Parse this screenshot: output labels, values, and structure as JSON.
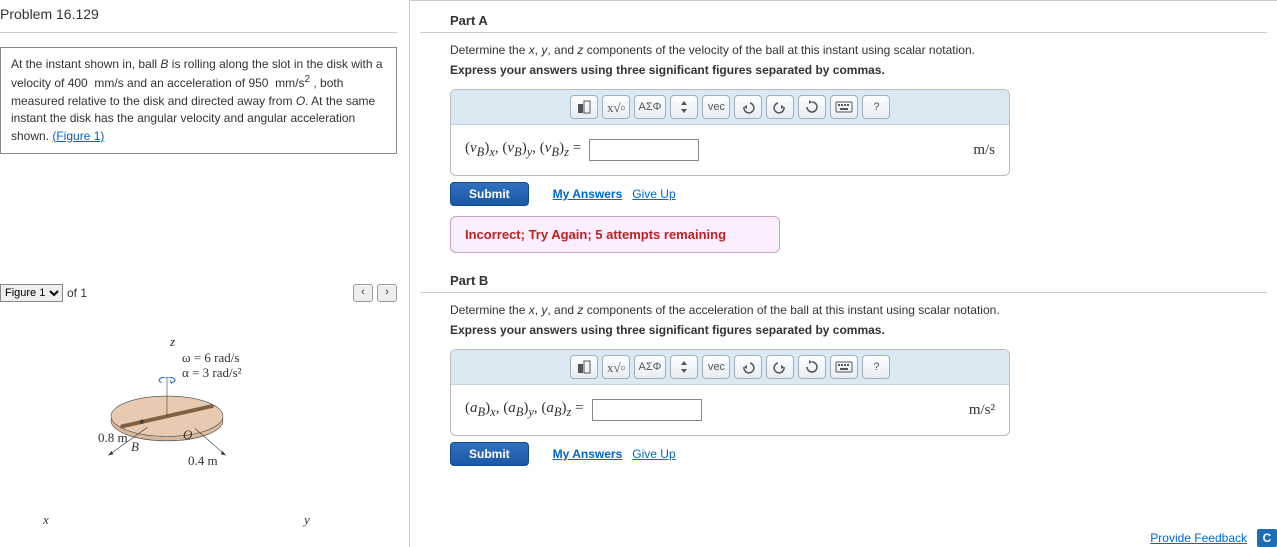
{
  "problem": {
    "title": "Problem 16.129",
    "description_lines": [
      "At the instant shown in, ball B is rolling along the slot in the disk with",
      "a velocity of 400 mm/s and an acceleration of 950 mm/s² , both",
      "measured relative to the disk and directed away from O. At the same",
      "instant the disk has the angular velocity and angular acceleration",
      "shown."
    ],
    "figure_link": "(Figure 1)",
    "figure_selector_value": "Figure 1",
    "figure_of_text": "of 1",
    "figure_labels": {
      "z": "z",
      "x": "x",
      "y": "y",
      "O": "O",
      "B": "B",
      "r1": "0.8 m",
      "r2": "0.4 m",
      "omega": "ω = 6 rad/s",
      "alpha": "α = 3 rad/s²"
    }
  },
  "partA": {
    "title": "Part A",
    "prompt": "Determine the x, y, and z components of the velocity of the ball at this instant using scalar notation.",
    "instr": "Express your answers using three significant figures separated by commas.",
    "lhs": "(vB)x, (vB)y, (vB)z =",
    "units": "m/s",
    "submit": "Submit",
    "my_answers": "My Answers",
    "give_up": "Give Up",
    "feedback": "Incorrect; Try Again; 5 attempts remaining"
  },
  "partB": {
    "title": "Part B",
    "prompt": "Determine the x, y, and z components of the acceleration of the ball at this instant using scalar notation.",
    "instr": "Express your answers using three significant figures separated by commas.",
    "lhs": "(aB)x, (aB)y, (aB)z =",
    "units": "m/s²",
    "submit": "Submit",
    "my_answers": "My Answers",
    "give_up": "Give Up"
  },
  "toolbar": {
    "greek": "ΑΣΦ",
    "vec": "vec",
    "help": "?"
  },
  "footer": {
    "provide_feedback": "Provide Feedback",
    "badge": "C"
  }
}
